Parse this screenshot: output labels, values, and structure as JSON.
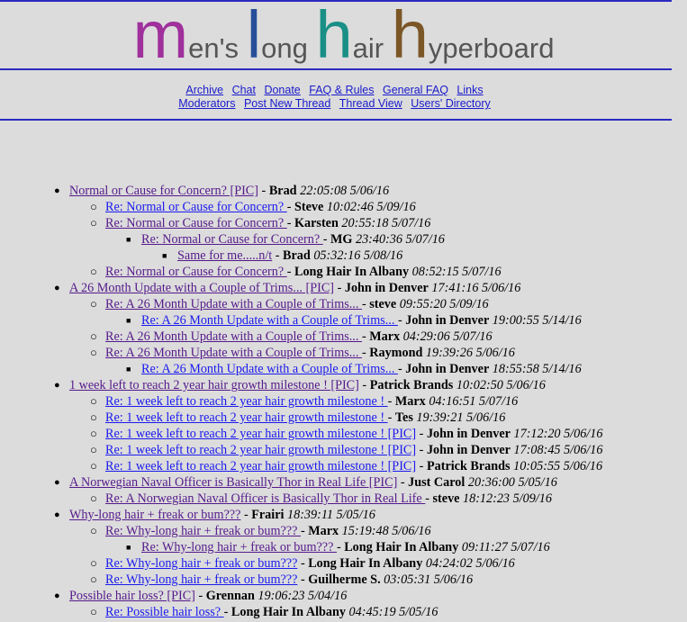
{
  "title": {
    "words": [
      {
        "big": "m",
        "rest": "en's",
        "color": "#a0309c"
      },
      {
        "big": "l",
        "rest": "ong",
        "color": "#264f9a"
      },
      {
        "big": "h",
        "rest": "air",
        "color": "#1a8f86"
      },
      {
        "big": "h",
        "rest": "yperboard",
        "color": "#7b5626"
      }
    ]
  },
  "nav": {
    "row1": [
      "Archive",
      "Chat",
      "Donate",
      "FAQ & Rules",
      "General FAQ",
      "Links"
    ],
    "row2": [
      "Moderators",
      "Post New Thread",
      "Thread View",
      "Users' Directory"
    ]
  },
  "posts": [
    {
      "depth": 0,
      "subject": "Normal or Cause for Concern? [PIC]",
      "author": "Brad",
      "date": "22:05:08 5/06/16",
      "visited": true
    },
    {
      "depth": 1,
      "subject": "Re: Normal or Cause for Concern? ",
      "author": "Steve",
      "date": "10:02:46 5/09/16",
      "visited": false
    },
    {
      "depth": 1,
      "subject": "Re: Normal or Cause for Concern? ",
      "author": "Karsten",
      "date": "20:55:18 5/07/16",
      "visited": true
    },
    {
      "depth": 2,
      "subject": "Re: Normal or Cause for Concern? ",
      "author": "MG",
      "date": "23:40:36 5/07/16",
      "visited": true
    },
    {
      "depth": 3,
      "subject": "Same for me.....n/t",
      "author": "Brad",
      "date": "05:32:16 5/08/16",
      "visited": true
    },
    {
      "depth": 1,
      "subject": "Re: Normal or Cause for Concern? ",
      "author": "Long Hair In Albany",
      "date": "08:52:15 5/07/16",
      "visited": true
    },
    {
      "depth": 0,
      "subject": "A 26 Month Update with a Couple of Trims... [PIC]",
      "author": "John in Denver",
      "date": "17:41:16 5/06/16",
      "visited": true
    },
    {
      "depth": 1,
      "subject": "Re: A 26 Month Update with a Couple of Trims... ",
      "author": "steve",
      "date": "09:55:20 5/09/16",
      "visited": true
    },
    {
      "depth": 2,
      "subject": "Re: A 26 Month Update with a Couple of Trims... ",
      "author": "John in Denver",
      "date": "19:00:55 5/14/16",
      "visited": false
    },
    {
      "depth": 1,
      "subject": "Re: A 26 Month Update with a Couple of Trims... ",
      "author": "Marx",
      "date": "04:29:06 5/07/16",
      "visited": true
    },
    {
      "depth": 1,
      "subject": "Re: A 26 Month Update with a Couple of Trims... ",
      "author": "Raymond",
      "date": "19:39:26 5/06/16",
      "visited": true
    },
    {
      "depth": 2,
      "subject": "Re: A 26 Month Update with a Couple of Trims... ",
      "author": "John in Denver",
      "date": "18:55:58 5/14/16",
      "visited": false
    },
    {
      "depth": 0,
      "subject": "1 week left to reach 2 year hair growth milestone ! [PIC]",
      "author": "Patrick Brands",
      "date": "10:02:50 5/06/16",
      "visited": true
    },
    {
      "depth": 1,
      "subject": "Re: 1 week left to reach 2 year hair growth milestone ! ",
      "author": "Marx",
      "date": "04:16:51 5/07/16",
      "visited": false
    },
    {
      "depth": 1,
      "subject": "Re: 1 week left to reach 2 year hair growth milestone ! ",
      "author": "Tes",
      "date": "19:39:21 5/06/16",
      "visited": false
    },
    {
      "depth": 1,
      "subject": "Re: 1 week left to reach 2 year hair growth milestone ! [PIC]",
      "author": "John in Denver",
      "date": "17:12:20 5/06/16",
      "visited": false
    },
    {
      "depth": 1,
      "subject": "Re: 1 week left to reach 2 year hair growth milestone ! [PIC]",
      "author": "John in Denver",
      "date": "17:08:45 5/06/16",
      "visited": false
    },
    {
      "depth": 1,
      "subject": "Re: 1 week left to reach 2 year hair growth milestone ! [PIC]",
      "author": "Patrick Brands",
      "date": "10:05:55 5/06/16",
      "visited": false
    },
    {
      "depth": 0,
      "subject": "A Norwegian Naval Officer is Basically Thor in Real Life [PIC]",
      "author": "Just Carol",
      "date": "20:36:00 5/05/16",
      "visited": true
    },
    {
      "depth": 1,
      "subject": "Re: A Norwegian Naval Officer is Basically Thor in Real Life ",
      "author": "steve",
      "date": "18:12:23 5/09/16",
      "visited": true
    },
    {
      "depth": 0,
      "subject": "Why-long hair + freak or bum???",
      "author": "Frairi",
      "date": "18:39:11 5/05/16",
      "visited": true
    },
    {
      "depth": 1,
      "subject": "Re: Why-long hair + freak or bum??? ",
      "author": "Marx",
      "date": "15:19:48 5/06/16",
      "visited": true
    },
    {
      "depth": 2,
      "subject": "Re: Why-long hair + freak or bum??? ",
      "author": "Long Hair In Albany",
      "date": "09:11:27 5/07/16",
      "visited": true
    },
    {
      "depth": 1,
      "subject": "Re: Why-long hair + freak or bum???",
      "author": "Long Hair In Albany",
      "date": "04:24:02 5/06/16",
      "visited": false
    },
    {
      "depth": 1,
      "subject": "Re: Why-long hair + freak or bum???",
      "author": "Guilherme S.",
      "date": "03:05:31 5/06/16",
      "visited": false
    },
    {
      "depth": 0,
      "subject": "Possible hair loss? [PIC]",
      "author": "Grennan",
      "date": "19:06:23 5/04/16",
      "visited": true
    },
    {
      "depth": 1,
      "subject": "Re: Possible hair loss? ",
      "author": "Long Hair In Albany",
      "date": "04:45:19 5/05/16",
      "visited": false
    }
  ],
  "separator": " - ",
  "colors": {
    "visited": "#551a8b",
    "unvisited": "#1a1aee",
    "rule": "#2b2bc0",
    "background": "#dcdcdc"
  }
}
